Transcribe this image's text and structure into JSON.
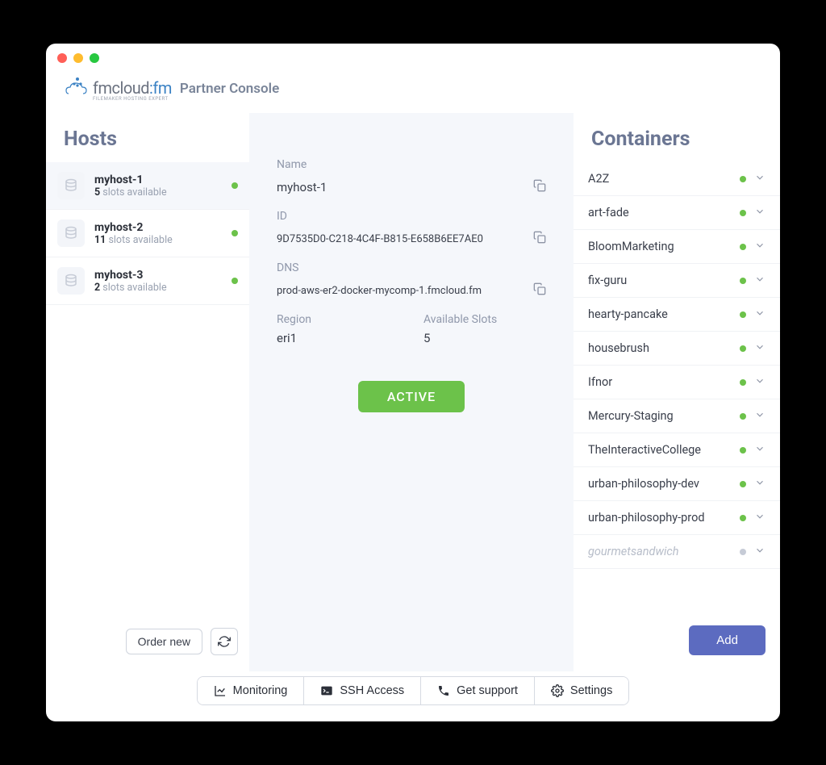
{
  "header": {
    "brand_part1": "fmcloud",
    "brand_part2": "fm",
    "brand_tagline": "FILEMAKER HOSTING EXPERT",
    "title": "Partner Console"
  },
  "hosts": {
    "title": "Hosts",
    "order_new": "Order new",
    "slots_suffix": " slots available",
    "items": [
      {
        "name": "myhost-1",
        "slots": "5",
        "selected": true
      },
      {
        "name": "myhost-2",
        "slots": "11",
        "selected": false
      },
      {
        "name": "myhost-3",
        "slots": "2",
        "selected": false
      }
    ]
  },
  "detail": {
    "name_label": "Name",
    "name_value": "myhost-1",
    "id_label": "ID",
    "id_value": "9D7535D0-C218-4C4F-B815-E658B6EE7AE0",
    "dns_label": "DNS",
    "dns_value": "prod-aws-er2-docker-mycomp-1.fmcloud.fm",
    "region_label": "Region",
    "region_value": "eri1",
    "slots_label": "Available Slots",
    "slots_value": "5",
    "status": "ACTIVE"
  },
  "containers": {
    "title": "Containers",
    "add": "Add",
    "items": [
      {
        "name": "A2Z",
        "active": true
      },
      {
        "name": "art-fade",
        "active": true
      },
      {
        "name": "BloomMarketing",
        "active": true
      },
      {
        "name": "fix-guru",
        "active": true
      },
      {
        "name": "hearty-pancake",
        "active": true
      },
      {
        "name": "housebrush",
        "active": true
      },
      {
        "name": "Ifnor",
        "active": true
      },
      {
        "name": "Mercury-Staging",
        "active": true
      },
      {
        "name": "TheInteractiveCollege",
        "active": true
      },
      {
        "name": "urban-philosophy-dev",
        "active": true
      },
      {
        "name": "urban-philosophy-prod",
        "active": true
      },
      {
        "name": "gourmetsandwich",
        "active": false
      }
    ]
  },
  "bottom": {
    "monitoring": "Monitoring",
    "ssh": "SSH Access",
    "support": "Get support",
    "settings": "Settings"
  }
}
